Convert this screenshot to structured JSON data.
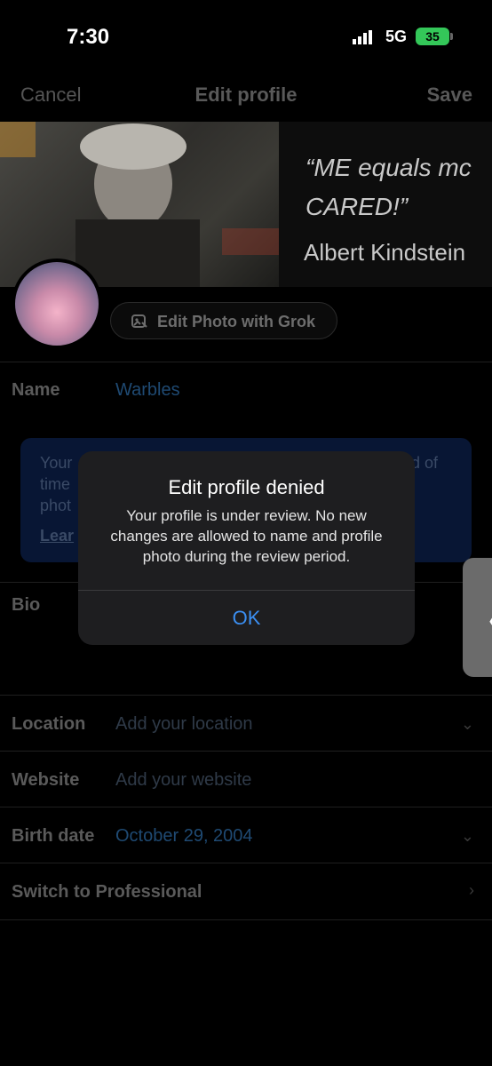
{
  "status_bar": {
    "time": "7:30",
    "network": "5G",
    "battery": "35"
  },
  "header": {
    "cancel": "Cancel",
    "title": "Edit profile",
    "save": "Save"
  },
  "banner": {
    "quote": "“ME equals mc CARED!”",
    "author": "Albert Kindstein"
  },
  "grok_button_label": "Edit Photo with Grok",
  "fields": {
    "name_label": "Name",
    "name_value": "Warbles",
    "bio_label": "Bio",
    "location_label": "Location",
    "location_placeholder": "Add your location",
    "website_label": "Website",
    "website_placeholder": "Add your website",
    "birthdate_label": "Birth date",
    "birthdate_value": "October 29, 2004",
    "professional_label": "Switch to Professional"
  },
  "info_box": {
    "line1": "Your",
    "line2": "time",
    "line3": "phot",
    "link": "Lear",
    "right_fragment": "d of"
  },
  "dialog": {
    "title": "Edit profile denied",
    "message": "Your profile is under review. No new changes are allowed to name and profile photo during the review period.",
    "ok": "OK"
  },
  "icons": {
    "signal": "signal-bars-icon",
    "grok": "image-edit-icon",
    "chevron": "chevron-icon",
    "scroll": "chevron-left-icon"
  }
}
